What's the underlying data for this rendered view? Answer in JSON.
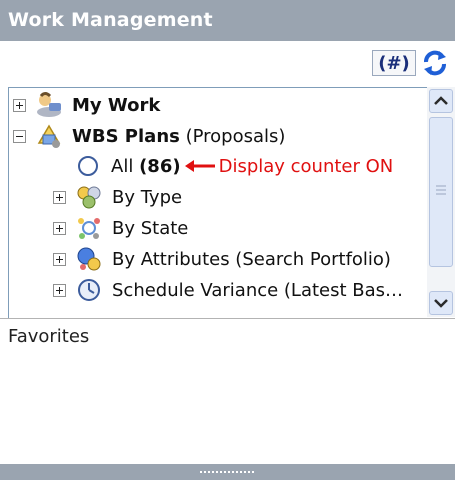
{
  "panel": {
    "title": "Work Management"
  },
  "toolbar": {
    "counter_label": "(#)",
    "refresh_icon": "refresh-icon"
  },
  "tree": {
    "items": [
      {
        "label": "My Work",
        "expander": "plus",
        "icon": "my-work-icon"
      },
      {
        "label": "WBS Plans",
        "suffix": "(Proposals)",
        "expander": "minus",
        "icon": "wbs-plans-icon"
      },
      {
        "label_prefix": "All",
        "count": "(86)",
        "icon": "radio-circle-icon"
      },
      {
        "label": "By Type",
        "expander": "plus",
        "icon": "by-type-icon"
      },
      {
        "label": "By State",
        "expander": "plus",
        "icon": "by-state-icon"
      },
      {
        "label": "By Attributes (Search Portfolio)",
        "expander": "plus",
        "icon": "by-attributes-icon"
      },
      {
        "label": "Schedule Variance (Latest Bas…",
        "expander": "plus",
        "icon": "schedule-variance-icon"
      }
    ]
  },
  "annotation": {
    "text": "Display counter ON",
    "color": "#e01010"
  },
  "favorites": {
    "title": "Favorites"
  },
  "colors": {
    "title_bar": "#9aa4b0",
    "counter_text": "#1b2f7a",
    "refresh": "#1f5fd6"
  }
}
